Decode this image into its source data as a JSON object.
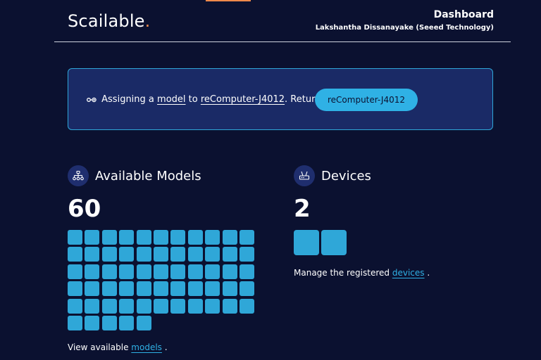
{
  "header": {
    "logo": "Scailable",
    "logo_dot": ".",
    "title": "Dashboard",
    "user": "Lakshantha Dissanayake  (Seeed Technology)"
  },
  "banner": {
    "prefix": "Assigning a",
    "model_link": "model",
    "to_text": "to",
    "device_link": "reComputer-J4012",
    "return_text": ". Return to",
    "button_label": "reComputer-J4012"
  },
  "models": {
    "title": "Available Models",
    "count": "60",
    "footer_prefix": "View available",
    "footer_link": "models",
    "footer_suffix": "."
  },
  "devices": {
    "title": "Devices",
    "count": "2",
    "footer_prefix": "Manage the registered",
    "footer_link": "devices",
    "footer_suffix": "."
  },
  "colors": {
    "background": "#0b1130",
    "accent": "#2fb1e5",
    "banner_bg": "#1a2a66",
    "logo_dot": "#f08a4b"
  },
  "icons": {
    "banner": "link-icon",
    "models": "network-icon",
    "devices": "router-icon"
  }
}
